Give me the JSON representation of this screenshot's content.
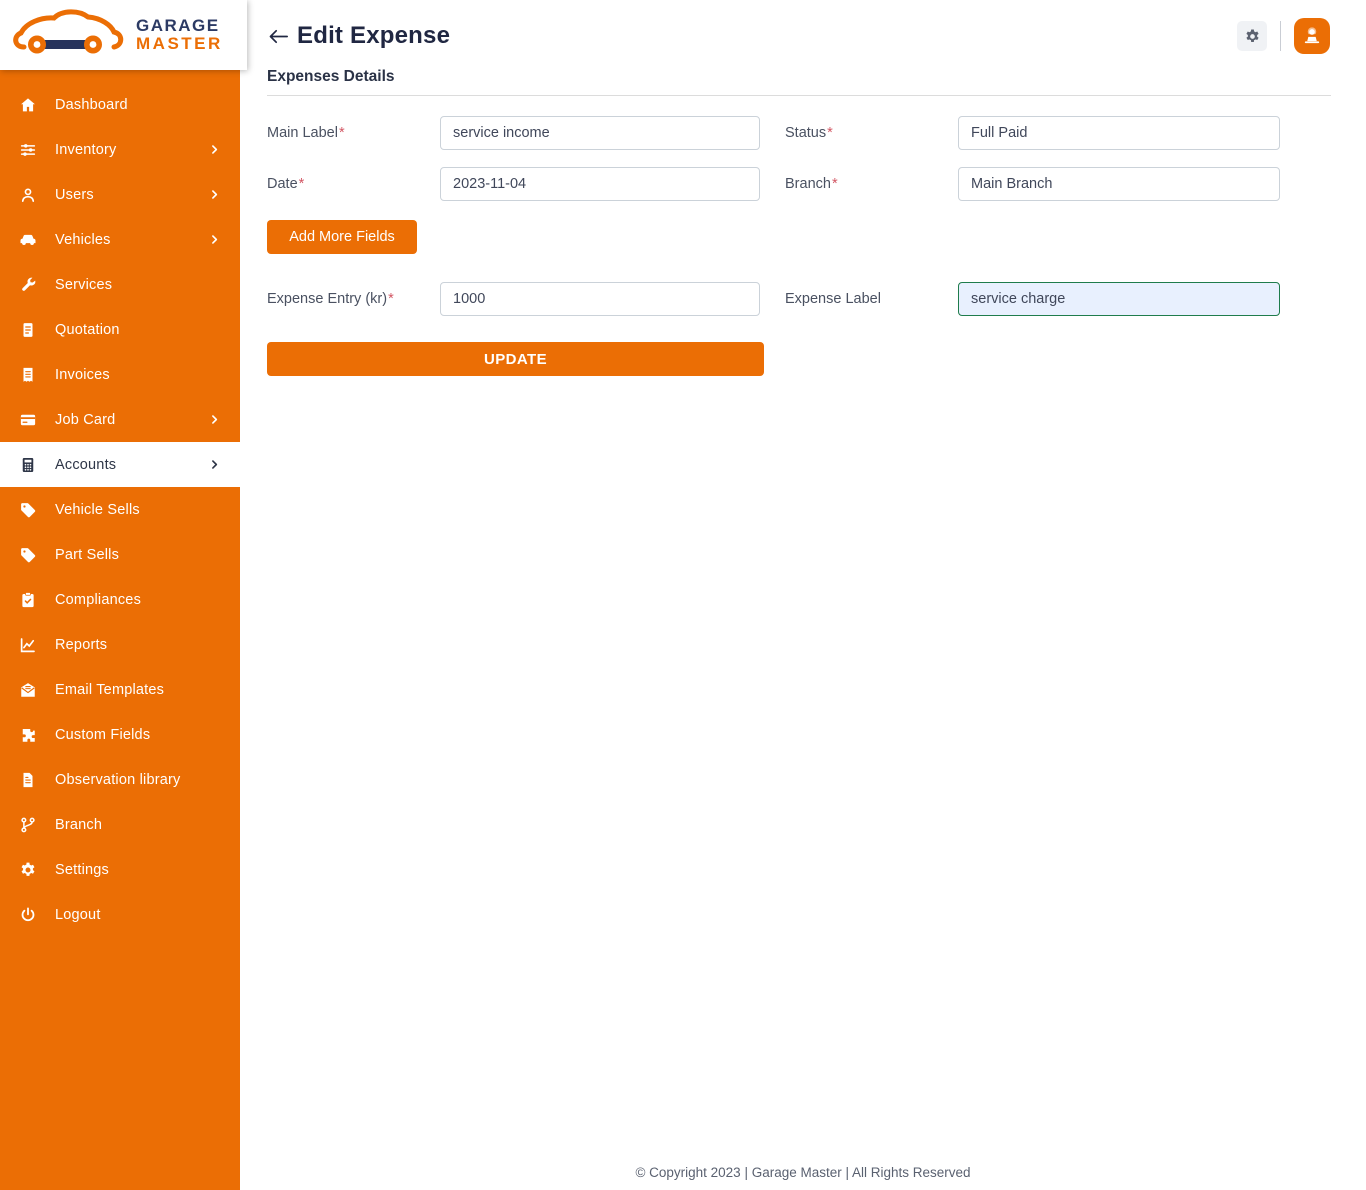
{
  "brand": {
    "line1": "GARAGE",
    "line2": "MASTER"
  },
  "header": {
    "title": "Edit Expense",
    "back_icon": "arrow-left-icon",
    "actions": {
      "settings_icon": "gear-icon",
      "profile_icon": "person-at-desk-icon"
    }
  },
  "sidebar": {
    "items": [
      {
        "label": "Dashboard",
        "icon": "home-icon",
        "has_submenu": false,
        "active": false
      },
      {
        "label": "Inventory",
        "icon": "sliders-icon",
        "has_submenu": true,
        "active": false
      },
      {
        "label": "Users",
        "icon": "user-icon",
        "has_submenu": true,
        "active": false
      },
      {
        "label": "Vehicles",
        "icon": "car-icon",
        "has_submenu": true,
        "active": false
      },
      {
        "label": "Services",
        "icon": "wrench-icon",
        "has_submenu": false,
        "active": false
      },
      {
        "label": "Quotation",
        "icon": "document-icon",
        "has_submenu": false,
        "active": false
      },
      {
        "label": "Invoices",
        "icon": "receipt-icon",
        "has_submenu": false,
        "active": false
      },
      {
        "label": "Job Card",
        "icon": "credit-card-icon",
        "has_submenu": true,
        "active": false
      },
      {
        "label": "Accounts",
        "icon": "calculator-icon",
        "has_submenu": true,
        "active": true
      },
      {
        "label": "Vehicle Sells",
        "icon": "tag-icon",
        "has_submenu": false,
        "active": false
      },
      {
        "label": "Part Sells",
        "icon": "tag-icon",
        "has_submenu": false,
        "active": false
      },
      {
        "label": "Compliances",
        "icon": "clipboard-check-icon",
        "has_submenu": false,
        "active": false
      },
      {
        "label": "Reports",
        "icon": "chart-line-icon",
        "has_submenu": false,
        "active": false
      },
      {
        "label": "Email Templates",
        "icon": "envelope-icon",
        "has_submenu": false,
        "active": false
      },
      {
        "label": "Custom Fields",
        "icon": "puzzle-icon",
        "has_submenu": false,
        "active": false
      },
      {
        "label": "Observation library",
        "icon": "file-icon",
        "has_submenu": false,
        "active": false
      },
      {
        "label": "Branch",
        "icon": "git-branch-icon",
        "has_submenu": false,
        "active": false
      },
      {
        "label": "Settings",
        "icon": "gear-icon",
        "has_submenu": false,
        "active": false
      },
      {
        "label": "Logout",
        "icon": "power-icon",
        "has_submenu": false,
        "active": false
      }
    ]
  },
  "form": {
    "section_title": "Expenses Details",
    "required_mark": "*",
    "fields": {
      "main_label": {
        "label": "Main Label",
        "required": true,
        "value": "service income"
      },
      "status": {
        "label": "Status",
        "required": true,
        "value": "Full Paid"
      },
      "date": {
        "label": "Date",
        "required": true,
        "value": "2023-11-04"
      },
      "branch": {
        "label": "Branch",
        "required": true,
        "value": "Main Branch"
      },
      "expense_entry": {
        "label": "Expense Entry (kr)",
        "required": true,
        "value": "1000"
      },
      "expense_label": {
        "label": "Expense Label",
        "required": false,
        "value": "service charge"
      }
    },
    "add_more_button": "Add More Fields",
    "update_button": "UPDATE"
  },
  "footer": {
    "copyright": "© Copyright 2023 | Garage Master | All Rights Reserved"
  },
  "colors": {
    "accent_orange": "#EB6E05",
    "active_item_text": "#2E3648",
    "required_mark": "#D25663",
    "highlight_border_green": "#1F7C4C",
    "highlight_bg": "#E8F0FE"
  }
}
